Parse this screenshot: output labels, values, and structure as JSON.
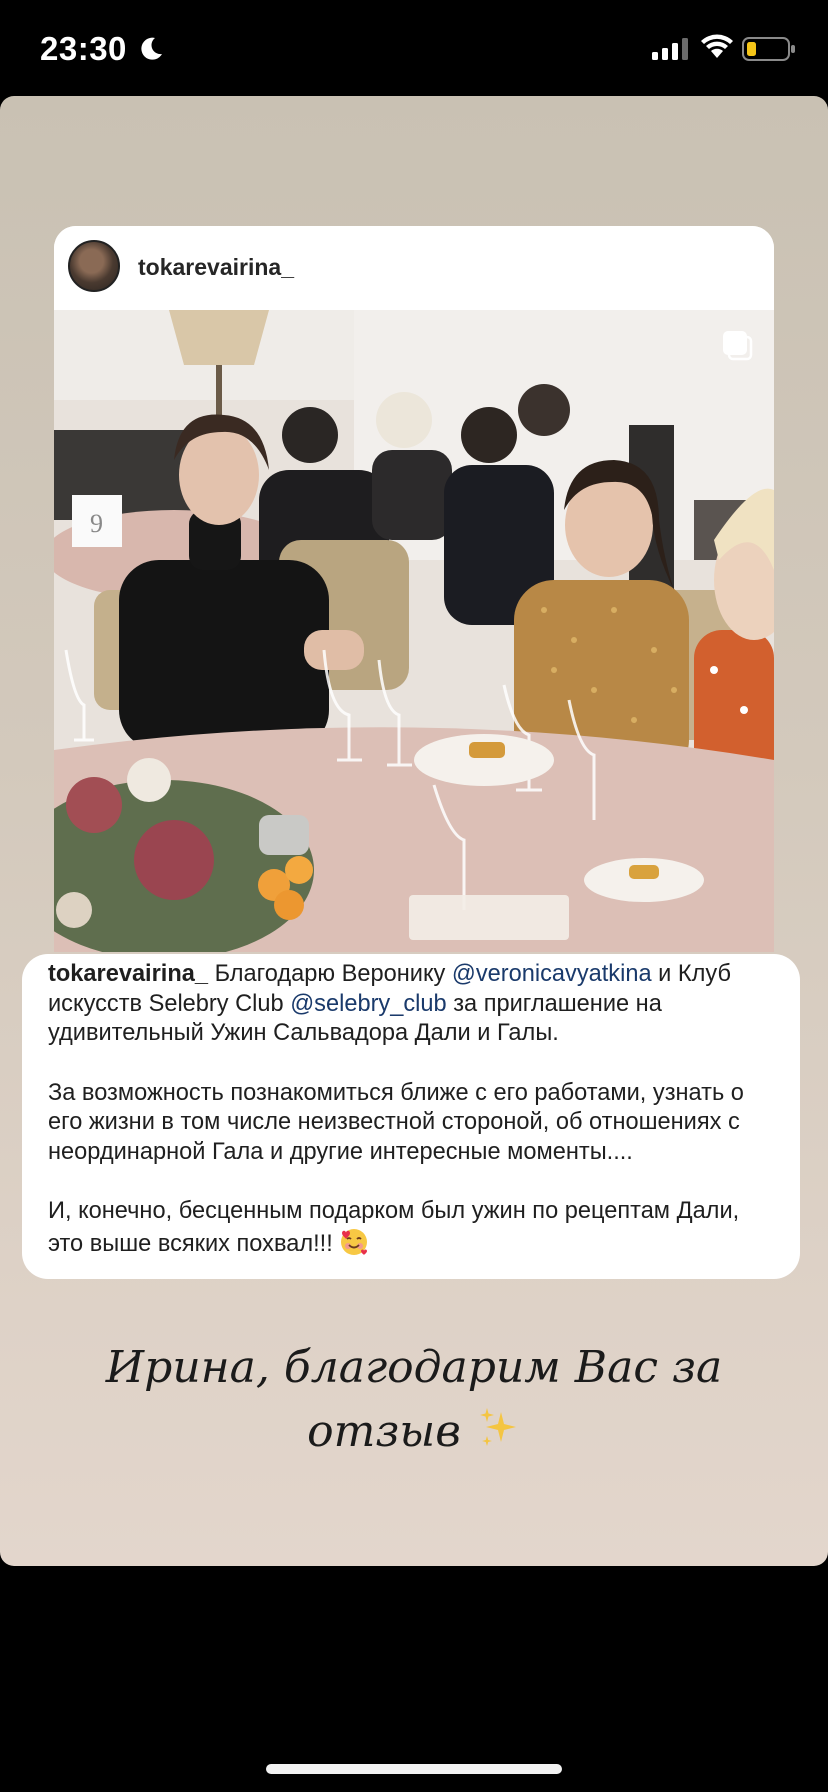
{
  "status_bar": {
    "time": "23:30",
    "icons": [
      "moon-icon",
      "cellular-signal-icon",
      "wifi-icon",
      "battery-icon"
    ],
    "battery_color": "#f5c518"
  },
  "post": {
    "username": "tokarevairina_",
    "photo_description_icon": "multiple-photos-icon"
  },
  "caption": {
    "username": "tokarevairina_",
    "text1": " Благодарю Веронику ",
    "mention1": "@veronicavyatkina",
    "text2": " и Клуб искусств Selebry Club ",
    "mention2": "@selebry_club",
    "text3": " за приглашение на удивительный Ужин Сальвадора Дали и Галы.",
    "paragraph2": "За возможность познакомиться ближе с его работами, узнать о его жизни в том числе неизвестной стороной, об отношениях с неординарной Гала и другие интересные моменты....",
    "paragraph3": "И, конечно, бесценным подарком был ужин по рецептам Дали, это выше всяких похвал!!! ",
    "emoji": "smiling-face-with-hearts-icon"
  },
  "story_text": {
    "line1": "Ирина, благодарим Вас за",
    "line2": "отзыв "
  },
  "colors": {
    "mention": "#1a3a6b",
    "background_top": "#c9c1b3",
    "background_bottom": "#e3d6cc"
  }
}
